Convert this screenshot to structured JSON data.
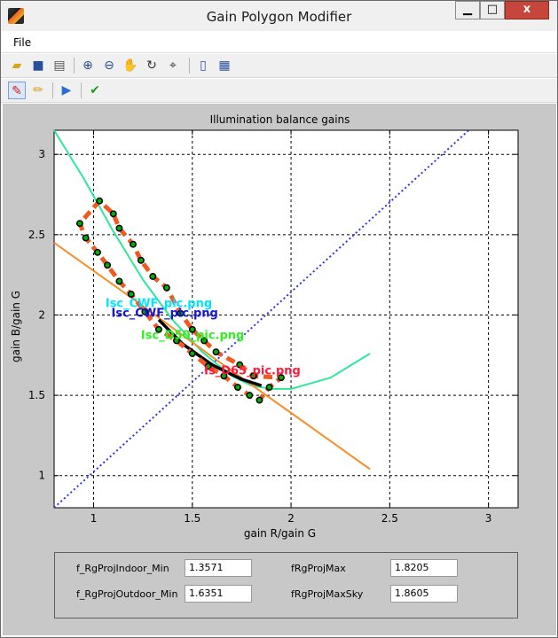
{
  "window": {
    "title": "Gain Polygon Modifier",
    "minimize": "▁",
    "maximize": "□",
    "close": "x"
  },
  "menu": {
    "file": "File"
  },
  "toolbar_top": [
    "open-icon",
    "save-icon",
    "print-icon",
    "zoom-in-icon",
    "zoom-out-icon",
    "pan-icon",
    "rotate-icon",
    "data-cursor-icon",
    "colorbar-icon",
    "legend-icon"
  ],
  "toolbar_bottom": [
    "edit-polygon-icon",
    "pencil-icon",
    "play-icon",
    "check-icon"
  ],
  "chart_data": {
    "type": "line",
    "title": "Illumination balance gains",
    "xlabel": "gain R/gain G",
    "ylabel": "gain B/gain G",
    "xlim": [
      0.8,
      3.15
    ],
    "ylim": [
      0.8,
      3.15
    ],
    "xticks": [
      "1",
      "1.5",
      "2",
      "2.5",
      "3"
    ],
    "yticks": [
      "1",
      "1.5",
      "2",
      "2.5",
      "3"
    ],
    "grid": true,
    "series": [
      {
        "color": "#2f35e6",
        "style": "dotted",
        "x": [
          0.8,
          2.9
        ],
        "y": [
          0.8,
          3.15
        ]
      },
      {
        "color": "#2ee89a",
        "style": "solid",
        "x": [
          0.8,
          0.95,
          1.1,
          1.25,
          1.4,
          1.55,
          1.7,
          1.8,
          1.9,
          2.0,
          2.2,
          2.4
        ],
        "y": [
          3.15,
          2.85,
          2.52,
          2.22,
          1.97,
          1.77,
          1.62,
          1.56,
          1.54,
          1.54,
          1.61,
          1.76
        ]
      },
      {
        "color": "#f48f2a",
        "style": "solid",
        "x": [
          0.8,
          1.2,
          1.6,
          2.0,
          2.4
        ],
        "y": [
          2.45,
          2.1,
          1.74,
          1.39,
          1.04
        ]
      },
      {
        "color": "#000000",
        "style": "solid",
        "x": [
          1.33,
          1.45,
          1.6,
          1.75,
          1.85
        ],
        "y": [
          1.97,
          1.82,
          1.69,
          1.6,
          1.56
        ]
      },
      {
        "color": "#ef5a21",
        "style": "dashed",
        "markers": true,
        "x": [
          1.03,
          0.93,
          0.96,
          1.02,
          1.07,
          1.13,
          1.19,
          1.26,
          1.33,
          1.42,
          1.5,
          1.58,
          1.66,
          1.73,
          1.79,
          1.84,
          1.89,
          1.95,
          1.81,
          1.74,
          1.62,
          1.56,
          1.5,
          1.44,
          1.37,
          1.3,
          1.24,
          1.2,
          1.13,
          1.1,
          1.03
        ],
        "y": [
          2.71,
          2.57,
          2.48,
          2.39,
          2.31,
          2.21,
          2.13,
          2.02,
          1.91,
          1.84,
          1.76,
          1.68,
          1.62,
          1.55,
          1.5,
          1.47,
          1.55,
          1.61,
          1.62,
          1.69,
          1.77,
          1.84,
          1.91,
          2.01,
          2.17,
          2.24,
          2.34,
          2.44,
          2.54,
          2.63,
          2.71
        ]
      }
    ],
    "annotations": [
      {
        "text": "Isc_CWF_pic.png",
        "color": "#00e5ff",
        "x": 1.06,
        "y": 2.05
      },
      {
        "text": "Isc_CWF_pic.png",
        "color": "#1616d8",
        "x": 1.09,
        "y": 1.99
      },
      {
        "text": "Isc_D50_pic.png",
        "color": "#33ee22",
        "x": 1.24,
        "y": 1.85
      },
      {
        "text": "Is_D65_pic.png",
        "color": "#ff1a3a",
        "x": 1.56,
        "y": 1.63
      }
    ]
  },
  "panel": {
    "rows": [
      {
        "label1": "f_RgProjIndoor_Min",
        "value1": "1.3571",
        "label2": "fRgProjMax",
        "value2": "1.8205"
      },
      {
        "label1": "f_RgProjOutdoor_Min",
        "value1": "1.6351",
        "label2": "fRgProjMaxSky",
        "value2": "1.8605"
      }
    ]
  }
}
